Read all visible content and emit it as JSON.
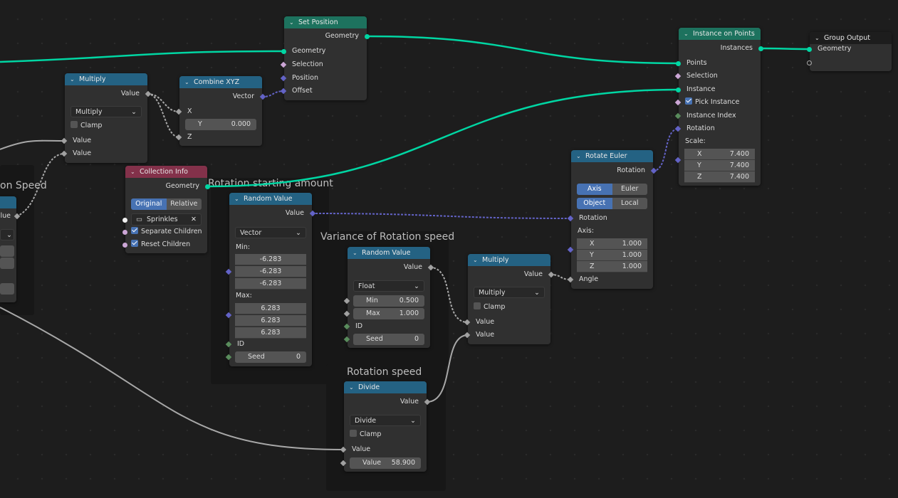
{
  "colors": {
    "geometry_header": "#1d725e",
    "converter_header": "#246283",
    "input_header": "#83314a",
    "output_header": "#1d1d1d",
    "geometry_socket": "#00d6a3",
    "vector_socket": "#6363c7",
    "float_socket": "#a1a1a1",
    "bool_socket": "#cca6d6",
    "int_socket": "#598c5c"
  },
  "frames": {
    "left": "on Speed",
    "rot_start": "Rotation starting amount",
    "variance": "Variance of Rotation speed",
    "speed": "Rotation speed"
  },
  "left_node": {
    "value": "lue"
  },
  "set_position": {
    "title": "Set Position",
    "out_geometry": "Geometry",
    "in_geometry": "Geometry",
    "selection": "Selection",
    "position": "Position",
    "offset": "Offset"
  },
  "multiply1": {
    "title": "Multiply",
    "out_value": "Value",
    "operation": "Multiply",
    "clamp": "Clamp",
    "value_a": "Value",
    "value_b": "Value"
  },
  "combine_xyz": {
    "title": "Combine XYZ",
    "out_vector": "Vector",
    "x": "X",
    "y_label": "Y",
    "y_value": "0.000",
    "z": "Z"
  },
  "collection_info": {
    "title": "Collection Info",
    "out_geometry": "Geometry",
    "mode_original": "Original",
    "mode_relative": "Relative",
    "collection": "Sprinkles",
    "separate_children": "Separate Children",
    "reset_children": "Reset Children"
  },
  "random_value1": {
    "title": "Random Value",
    "out_value": "Value",
    "type": "Vector",
    "min_label": "Min:",
    "min": [
      "-6.283",
      "-6.283",
      "-6.283"
    ],
    "max_label": "Max:",
    "max": [
      "6.283",
      "6.283",
      "6.283"
    ],
    "id": "ID",
    "seed_label": "Seed",
    "seed": "0"
  },
  "random_value2": {
    "title": "Random Value",
    "out_value": "Value",
    "type": "Float",
    "min_label": "Min",
    "min": "0.500",
    "max_label": "Max",
    "max": "1.000",
    "id": "ID",
    "seed_label": "Seed",
    "seed": "0"
  },
  "divide": {
    "title": "Divide",
    "out_value": "Value",
    "operation": "Divide",
    "clamp": "Clamp",
    "value_a": "Value",
    "value_b_label": "Value",
    "value_b": "58.900"
  },
  "multiply2": {
    "title": "Multiply",
    "out_value": "Value",
    "operation": "Multiply",
    "clamp": "Clamp",
    "value_a": "Value",
    "value_b": "Value"
  },
  "rotate_euler": {
    "title": "Rotate Euler",
    "out_rotation": "Rotation",
    "type_axis_angle": "Axis Angle",
    "type_euler": "Euler",
    "space_object": "Object",
    "space_local": "Local",
    "rotation": "Rotation",
    "axis_label": "Axis:",
    "axis": [
      {
        "k": "X",
        "v": "1.000"
      },
      {
        "k": "Y",
        "v": "1.000"
      },
      {
        "k": "Z",
        "v": "1.000"
      }
    ],
    "angle": "Angle"
  },
  "instance_on_points": {
    "title": "Instance on Points",
    "out_instances": "Instances",
    "points": "Points",
    "selection": "Selection",
    "instance": "Instance",
    "pick_instance": "Pick Instance",
    "instance_index": "Instance Index",
    "rotation": "Rotation",
    "scale_label": "Scale:",
    "scale": [
      {
        "k": "X",
        "v": "7.400"
      },
      {
        "k": "Y",
        "v": "7.400"
      },
      {
        "k": "Z",
        "v": "7.400"
      }
    ]
  },
  "group_output": {
    "title": "Group Output",
    "geometry": "Geometry"
  }
}
